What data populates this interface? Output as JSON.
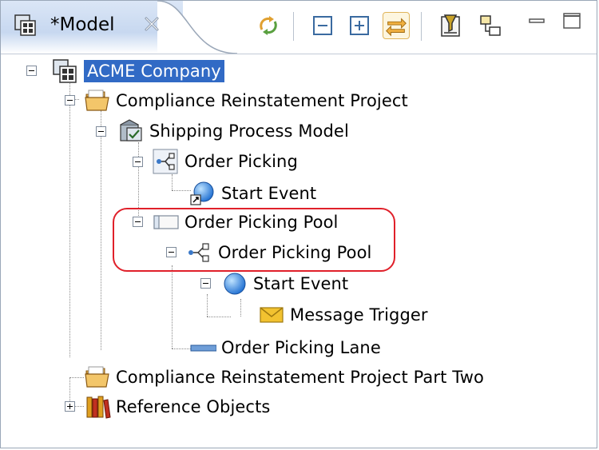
{
  "view": {
    "title": "*Model",
    "icons": {
      "view": "model-view-icon",
      "close": "close-icon",
      "sync": "sync-icon",
      "collapse": "collapse-all-icon",
      "expand": "expand-all-icon",
      "link": "link-with-editor-icon",
      "filter": "filter-icon",
      "layout": "layout-icon",
      "minimize": "minimize-icon",
      "maximize": "maximize-icon"
    }
  },
  "tree": {
    "items": [
      {
        "label": "ACME Company",
        "icon": "model-icon"
      },
      {
        "label": "Compliance Reinstatement Project",
        "icon": "folder-icon"
      },
      {
        "label": "Shipping Process Model",
        "icon": "process-model-icon"
      },
      {
        "label": "Order Picking",
        "icon": "process-icon"
      },
      {
        "label": "Start Event",
        "icon": "start-event-link-icon"
      },
      {
        "label": "Order Picking Pool",
        "icon": "pool-icon"
      },
      {
        "label": "Order Picking Pool",
        "icon": "process-icon"
      },
      {
        "label": "Start Event",
        "icon": "start-event-icon"
      },
      {
        "label": "Message Trigger",
        "icon": "message-icon"
      },
      {
        "label": "Order Picking Lane",
        "icon": "lane-icon"
      },
      {
        "label": "Compliance Reinstatement Project Part Two",
        "icon": "folder-icon"
      },
      {
        "label": "Reference Objects",
        "icon": "books-icon"
      }
    ]
  },
  "colors": {
    "selection": "#316ac5",
    "highlight": "#e0202a"
  }
}
